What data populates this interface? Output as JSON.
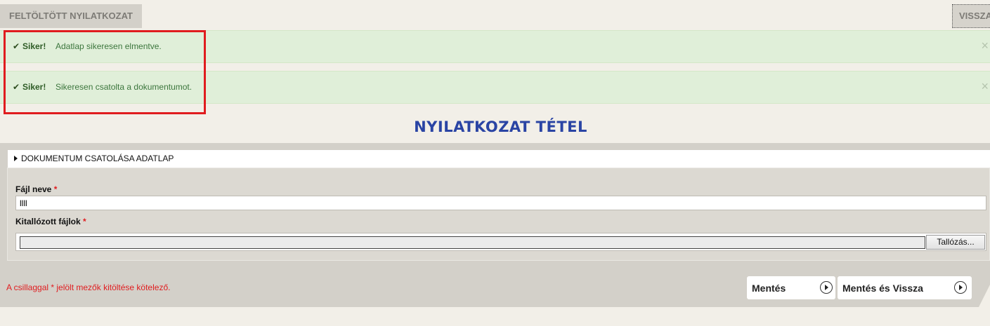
{
  "header": {
    "tab_title": "FELTÖLTÖTT NYILATKOZAT",
    "back_label": "VISSZA"
  },
  "alerts": [
    {
      "check_icon": "✔",
      "strong": "Siker!",
      "message": "Adatlap sikeresen elmentve.",
      "close": "×"
    },
    {
      "check_icon": "✔",
      "strong": "Siker!",
      "message": "Sikeresen csatolta a dokumentumot.",
      "close": "×"
    }
  ],
  "page_title": "NYILATKOZAT TÉTEL",
  "section": {
    "title": "DOKUMENTUM CSATOLÁSA ADATLAP"
  },
  "form": {
    "file_name_label": "Fájl neve",
    "file_name_value": "llll",
    "browsed_files_label": "Kitallózott fájlok",
    "required_mark": "*",
    "browse_button": "Tallózás..."
  },
  "footer": {
    "required_note": "A csillaggal * jelölt mezők kitöltése kötelező.",
    "save_button": "Mentés",
    "save_back_button": "Mentés és Vissza"
  },
  "colors": {
    "title_blue": "#2a44a4",
    "success_bg": "#e0efd9",
    "highlight_red": "#e01c1f"
  }
}
